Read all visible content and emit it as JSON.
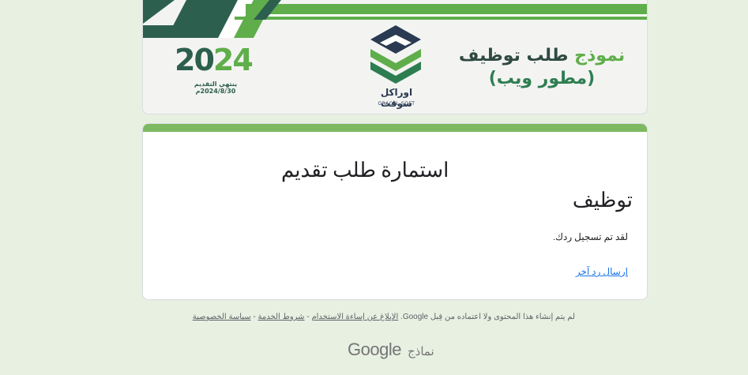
{
  "banner": {
    "title_part1": "نموذج",
    "title_part2": "طلب توظيف",
    "subtitle": "(مطور ويب)",
    "logo_name": "اوراكل سوفت",
    "logo_sub": "ORACEL SOFT",
    "year_part1": "20",
    "year_part2": "24",
    "deadline": "ينتهي التقديم 2024/8/30م",
    "colors": {
      "green": "#5fae4b",
      "dark": "#2d5f4e",
      "navy": "#2a3a52"
    }
  },
  "card": {
    "title_line1": "استمارة طلب تقديم",
    "title_line2": "توظيف",
    "confirmation": "لقد تم تسجيل ردك.",
    "submit_another": "إرسال رد آخر",
    "accent": "#7cb960"
  },
  "footer": {
    "disclaimer_text": "لم يتم إنشاء هذا المحتوى ولا اعتماده من قِبل Google.",
    "report_abuse": "الإبلاغ عن إساءة الاستخدام",
    "sep": " - ",
    "terms": "شروط الخدمة",
    "privacy": "سياسة الخصوصية",
    "brand_google": "Google",
    "brand_forms": "نماذج"
  }
}
